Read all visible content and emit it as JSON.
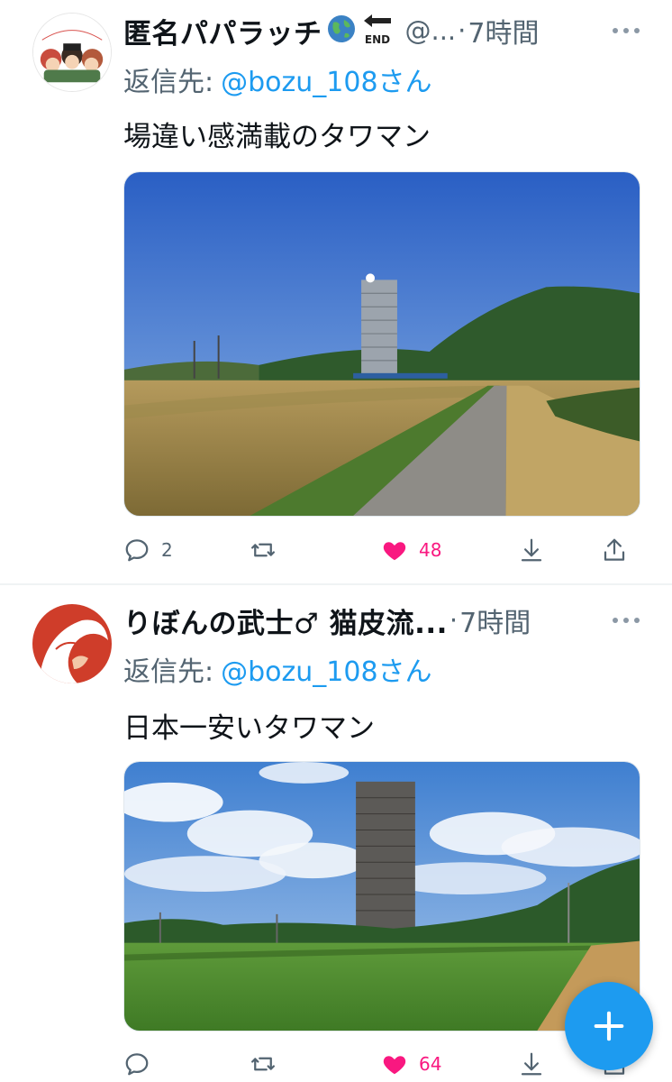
{
  "tweets": [
    {
      "display_name": "匿名パパラッチ",
      "name_icons": [
        "globe-icon",
        "end-arrow-icon"
      ],
      "handle": "@...",
      "separator": "·",
      "time": "7時間",
      "reply_prefix": "返信先:",
      "reply_handle": "@bozu_108さん",
      "text": "場違い感満載のタワマン",
      "avatar_text": "Congratulations!",
      "reply_count": "2",
      "retweet_count": "",
      "like_count": "48",
      "liked": true
    },
    {
      "display_name": "りぼんの武士♂ 猫皮流...",
      "handle": "",
      "separator": "·",
      "time": "7時間",
      "reply_prefix": "返信先:",
      "reply_handle": "@bozu_108さん",
      "text": "日本一安いタワマン",
      "reply_count": "",
      "retweet_count": "",
      "like_count": "64",
      "liked": true
    }
  ],
  "colors": {
    "accent": "#1d9bf0",
    "like": "#f91880",
    "secondary_text": "#536471",
    "primary_text": "#0f1419"
  },
  "icons": [
    "more-icon",
    "reply-icon",
    "retweet-icon",
    "heart-filled-icon",
    "share-icon",
    "upload-icon",
    "plus-icon"
  ]
}
